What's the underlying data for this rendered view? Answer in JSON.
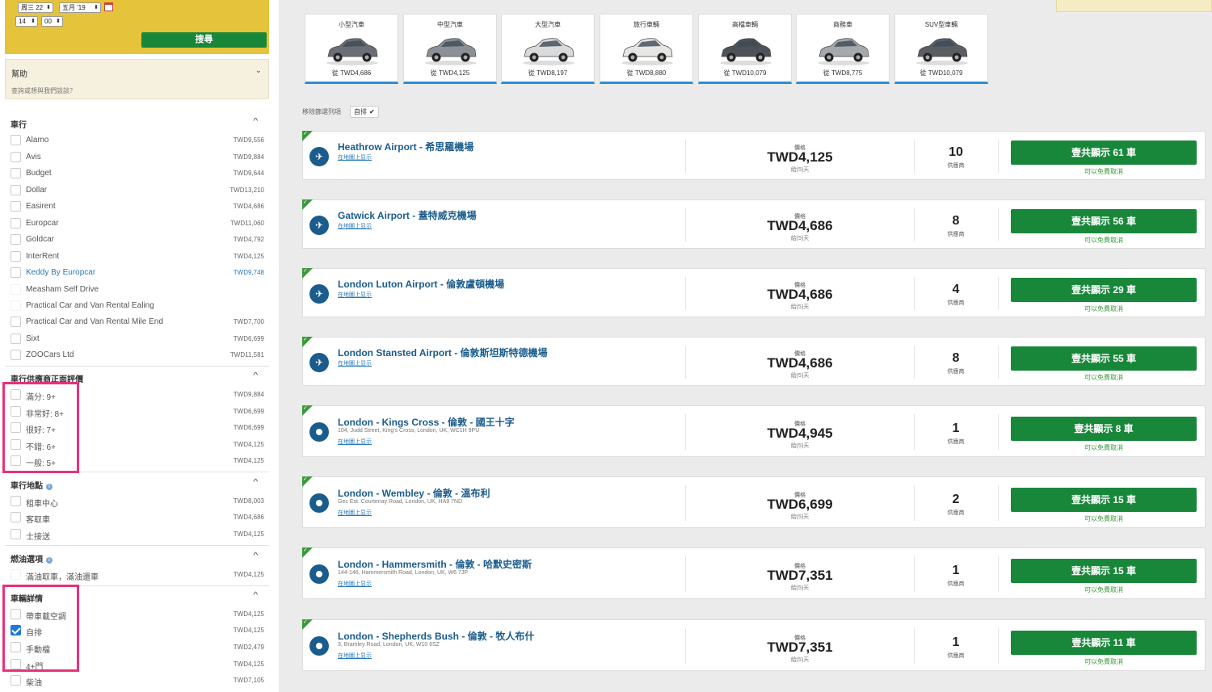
{
  "search": {
    "date_day": "周三 22",
    "date_month": "五月 '19",
    "hour": "14",
    "minute": "00",
    "search_button": "搜尋"
  },
  "help": {
    "title": "幫助",
    "subtitle": "查詢或想與我們談談？"
  },
  "suppliers": {
    "title": "車行",
    "items": [
      {
        "label": "Alamo",
        "price": "TWD9,556"
      },
      {
        "label": "Avis",
        "price": "TWD9,884"
      },
      {
        "label": "Budget",
        "price": "TWD9,644"
      },
      {
        "label": "Dollar",
        "price": "TWD13,210"
      },
      {
        "label": "Easirent",
        "price": "TWD4,686"
      },
      {
        "label": "Europcar",
        "price": "TWD11,060"
      },
      {
        "label": "Goldcar",
        "price": "TWD4,792"
      },
      {
        "label": "InterRent",
        "price": "TWD4,125"
      },
      {
        "label": "Keddy By Europcar",
        "price": "TWD9,748"
      },
      {
        "label": "Measham Self Drive",
        "price": ""
      },
      {
        "label": "Practical Car and Van Rental Ealing",
        "price": ""
      },
      {
        "label": "Practical Car and Van Rental Mile End",
        "price": "TWD7,700"
      },
      {
        "label": "Sixt",
        "price": "TWD6,699"
      },
      {
        "label": "ZOOCars Ltd",
        "price": "TWD11,581"
      }
    ]
  },
  "ratings": {
    "title": "車行供應商正面評價",
    "items": [
      {
        "label": "滿分: 9+",
        "price": "TWD9,884"
      },
      {
        "label": "非常好: 8+",
        "price": "TWD6,699"
      },
      {
        "label": "很好: 7+",
        "price": "TWD6,699"
      },
      {
        "label": "不錯: 6+",
        "price": "TWD4,125"
      },
      {
        "label": "一般: 5+",
        "price": "TWD4,125"
      }
    ]
  },
  "location": {
    "title": "車行地點",
    "items": [
      {
        "label": "租車中心",
        "price": "TWD8,003"
      },
      {
        "label": "客取車",
        "price": "TWD4,686"
      },
      {
        "label": "士接送",
        "price": "TWD4,125"
      }
    ]
  },
  "fuel": {
    "title": "燃油選項",
    "items": [
      {
        "label": "滿油取車，滿油還車",
        "price": "TWD4,125"
      }
    ]
  },
  "vehicle": {
    "title": "車輛詳情",
    "items": [
      {
        "label": "帶車載空調",
        "price": "TWD4,125"
      },
      {
        "label": "自排",
        "price": "TWD4,125"
      },
      {
        "label": "手動檔",
        "price": "TWD2,479"
      },
      {
        "label": "4+門",
        "price": "TWD4,125"
      },
      {
        "label": "柴油",
        "price": "TWD7,105"
      }
    ]
  },
  "categories": [
    {
      "name": "小型汽車",
      "price": "從 TWD4,686",
      "color": "#6b6f75"
    },
    {
      "name": "中型汽車",
      "price": "從 TWD4,125",
      "color": "#8b9096"
    },
    {
      "name": "大型汽車",
      "price": "從 TWD8,197",
      "color": "#d9dadc"
    },
    {
      "name": "旅行車輛",
      "price": "從 TWD8,880",
      "color": "#e6e6e4"
    },
    {
      "name": "高檔車輛",
      "price": "從 TWD10,079",
      "color": "#4e5258"
    },
    {
      "name": "商務車",
      "price": "從 TWD8,775",
      "color": "#a5a9ae"
    },
    {
      "name": "SUV型車輛",
      "price": "從 TWD10,079",
      "color": "#5a5e63"
    }
  ],
  "active_filters": {
    "label": "移除篩選列項",
    "chip": "自排",
    "chip_icon": "✔"
  },
  "results": [
    {
      "icon": "plane",
      "name": "Heathrow Airport - 希思羅機場",
      "address": "",
      "map": "在地圖上显示",
      "price_label": "價格",
      "price": "TWD4,125",
      "days": "給(5)天",
      "count": "10",
      "count_label": "供應商",
      "button": "壹共顯示 61 車",
      "cancel": "可以免費取消"
    },
    {
      "icon": "plane",
      "name": "Gatwick Airport - 蓋特威克機場",
      "address": "",
      "map": "在地圖上显示",
      "price_label": "價格",
      "price": "TWD4,686",
      "days": "給(5)天",
      "count": "8",
      "count_label": "供應商",
      "button": "壹共顯示 56 車",
      "cancel": "可以免費取消"
    },
    {
      "icon": "plane",
      "name": "London Luton Airport - 倫敦盧頓機場",
      "address": "",
      "map": "在地圖上显示",
      "price_label": "價格",
      "price": "TWD4,686",
      "days": "給(5)天",
      "count": "4",
      "count_label": "供應商",
      "button": "壹共顯示 29 車",
      "cancel": "可以免費取消"
    },
    {
      "icon": "plane",
      "name": "London Stansted Airport - 倫敦斯坦斯特德機場",
      "address": "",
      "map": "在地圖上显示",
      "price_label": "價格",
      "price": "TWD4,686",
      "days": "給(5)天",
      "count": "8",
      "count_label": "供應商",
      "button": "壹共顯示 55 車",
      "cancel": "可以免費取消"
    },
    {
      "icon": "location",
      "name": "London - Kings Cross - 倫敦 - 國王十字",
      "address": "104, Judd Street, King's Cross, London, UK, WC1H 9PU",
      "map": "在地圖上显示",
      "price_label": "價格",
      "price": "TWD4,945",
      "days": "給(5)天",
      "count": "1",
      "count_label": "供應商",
      "button": "壹共顯示 8 車",
      "cancel": "可以免費取消"
    },
    {
      "icon": "location",
      "name": "London - Wembley - 倫敦 - 溫布利",
      "address": "Gec Est. Courtenay Road, London, UK, HA9 7ND",
      "map": "在地圖上显示",
      "price_label": "價格",
      "price": "TWD6,699",
      "days": "給(5)天",
      "count": "2",
      "count_label": "供應商",
      "button": "壹共顯示 15 車",
      "cancel": "可以免費取消"
    },
    {
      "icon": "location",
      "name": "London - Hammersmith - 倫敦 - 哈默史密斯",
      "address": "144-146, Hammersmith Road, London, UK, W6 7JP",
      "map": "在地圖上显示",
      "price_label": "價格",
      "price": "TWD7,351",
      "days": "給(5)天",
      "count": "1",
      "count_label": "供應商",
      "button": "壹共顯示 15 車",
      "cancel": "可以免費取消"
    },
    {
      "icon": "location",
      "name": "London - Shepherds Bush - 倫敦 - 牧人布什",
      "address": "3, Bramley Road, London, UK, W10 6SZ",
      "map": "在地圖上显示",
      "price_label": "價格",
      "price": "TWD7,351",
      "days": "給(5)天",
      "count": "1",
      "count_label": "供應商",
      "button": "壹共顯示 11 車",
      "cancel": "可以免費取消"
    }
  ],
  "colors": {
    "brand_green": "#19873a",
    "link_blue": "#1a5c8c",
    "search_yellow": "#e5c33a",
    "highlight_pink": "#e8317a",
    "tile_underline": "#2b8fd6"
  }
}
